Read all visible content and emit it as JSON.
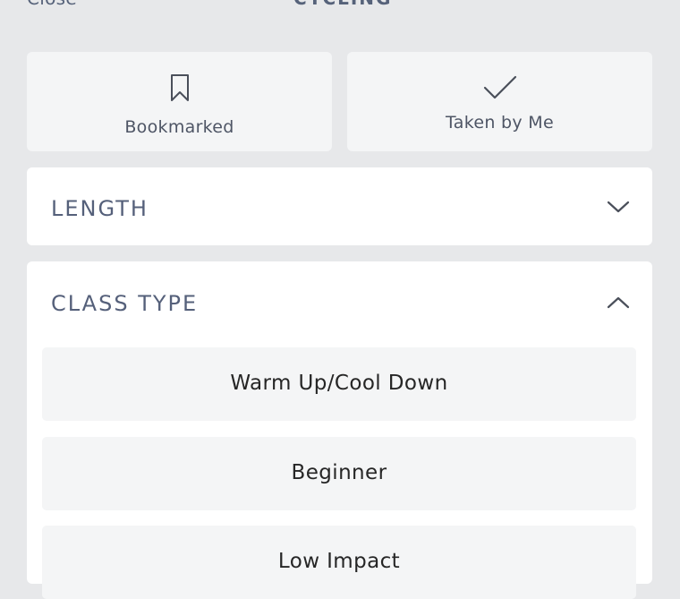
{
  "topbar": {
    "close_label": "Close",
    "title": "CYCLING"
  },
  "quick_filters": [
    {
      "label": "Bookmarked",
      "icon": "bookmark-icon"
    },
    {
      "label": "Taken by Me",
      "icon": "checkmark-icon"
    }
  ],
  "sections": {
    "length": {
      "title": "LENGTH",
      "expanded": false,
      "icon": "chevron-down-icon"
    },
    "class_type": {
      "title": "CLASS TYPE",
      "expanded": true,
      "icon": "chevron-up-icon",
      "options": [
        "Warm Up/Cool Down",
        "Beginner",
        "Low Impact"
      ]
    }
  },
  "colors": {
    "background": "#e7e8ea",
    "card": "#ffffff",
    "tile": "#f4f5f6",
    "section_title": "#55607a",
    "option_text": "#262626"
  }
}
